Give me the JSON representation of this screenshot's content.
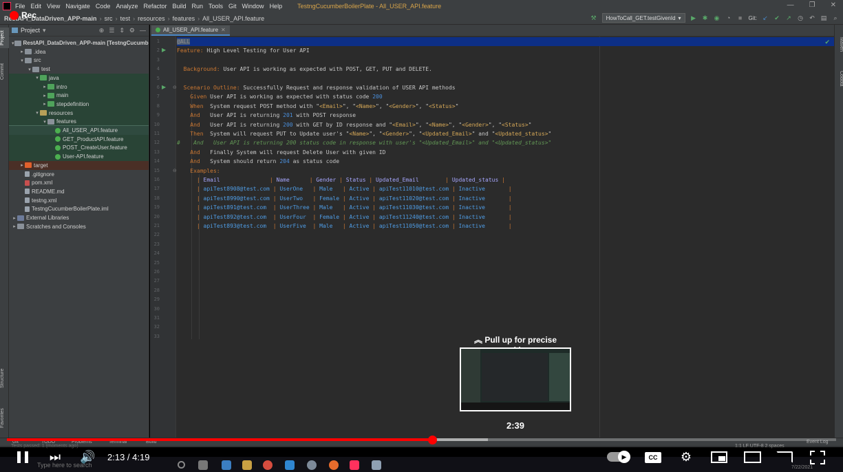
{
  "menubar": {
    "items": [
      "File",
      "Edit",
      "View",
      "Navigate",
      "Code",
      "Analyze",
      "Refactor",
      "Build",
      "Run",
      "Tools",
      "Git",
      "Window",
      "Help"
    ],
    "window_title": "TestngCucumberBoilerPlate - All_USER_API.feature"
  },
  "recording": {
    "label": "Rec"
  },
  "navbar": {
    "breadcrumbs": [
      "RestAPI_DataDriven_APP-main",
      "src",
      "test",
      "resources",
      "features",
      "All_USER_API.feature"
    ],
    "run_config": "HowToCall_GET.testGivenId",
    "git_label": "Git:"
  },
  "side_tabs": {
    "left": [
      "Project",
      "Commit",
      "Structure",
      "Favorites"
    ],
    "right": [
      "Maven",
      "Codota"
    ]
  },
  "project_panel": {
    "title": "Project",
    "tree": [
      {
        "label": "RestAPI_DataDriven_APP-main [TestngCucumberBo",
        "indent": 0,
        "arrow": "▾",
        "icon": "folder"
      },
      {
        "label": ".idea",
        "indent": 1,
        "arrow": "▸",
        "icon": "folder"
      },
      {
        "label": "src",
        "indent": 1,
        "arrow": "▾",
        "icon": "folder"
      },
      {
        "label": "test",
        "indent": 2,
        "arrow": "▾",
        "icon": "folder"
      },
      {
        "label": "java",
        "indent": 3,
        "arrow": "▾",
        "icon": "folder-test",
        "style": "green"
      },
      {
        "label": "intro",
        "indent": 4,
        "arrow": "▸",
        "icon": "folder-test",
        "style": "green"
      },
      {
        "label": "main",
        "indent": 4,
        "arrow": "▸",
        "icon": "folder-test",
        "style": "green"
      },
      {
        "label": "stepdefinition",
        "indent": 4,
        "arrow": "▸",
        "icon": "folder-test",
        "style": "green"
      },
      {
        "label": "resources",
        "indent": 3,
        "arrow": "▾",
        "icon": "folder-res",
        "style": "green"
      },
      {
        "label": "features",
        "indent": 4,
        "arrow": "▾",
        "icon": "folder",
        "style": "green"
      },
      {
        "label": "All_USER_API.feature",
        "indent": 5,
        "arrow": "",
        "icon": "cuke",
        "style": "sel"
      },
      {
        "label": "GET_ProductAPI.feature",
        "indent": 5,
        "arrow": "",
        "icon": "cuke",
        "style": "green"
      },
      {
        "label": "POST_CreateUser.feature",
        "indent": 5,
        "arrow": "",
        "icon": "cuke",
        "style": "green"
      },
      {
        "label": "User-API.feature",
        "indent": 5,
        "arrow": "",
        "icon": "cuke",
        "style": "green"
      },
      {
        "label": "target",
        "indent": 1,
        "arrow": "▸",
        "icon": "folder-target",
        "style": "red"
      },
      {
        "label": ".gitignore",
        "indent": 1,
        "arrow": "",
        "icon": "file"
      },
      {
        "label": "pom.xml",
        "indent": 1,
        "arrow": "",
        "icon": "mvn"
      },
      {
        "label": "README.md",
        "indent": 1,
        "arrow": "",
        "icon": "file"
      },
      {
        "label": "testng.xml",
        "indent": 1,
        "arrow": "",
        "icon": "file"
      },
      {
        "label": "TestngCucumberBoilerPlate.iml",
        "indent": 1,
        "arrow": "",
        "icon": "file"
      },
      {
        "label": "External Libraries",
        "indent": 0,
        "arrow": "▸",
        "icon": "lib"
      },
      {
        "label": "Scratches and Consoles",
        "indent": 0,
        "arrow": "▸",
        "icon": "folder"
      }
    ]
  },
  "editor": {
    "tab_label": "All_USER_API.feature",
    "lines": [
      {
        "n": 1,
        "current": true,
        "segs": [
          [
            "tag",
            "@ALL"
          ]
        ]
      },
      {
        "n": 2,
        "run": true,
        "segs": [
          [
            "kw",
            "Feature:"
          ],
          [
            "tx",
            " High Level Testing for User API"
          ]
        ]
      },
      {
        "n": 3,
        "segs": []
      },
      {
        "n": 4,
        "segs": [
          [
            "tx",
            "  "
          ],
          [
            "kw",
            "Background:"
          ],
          [
            "tx",
            " User API is working as expected with POST, GET, PUT and DELETE."
          ]
        ]
      },
      {
        "n": 5,
        "segs": []
      },
      {
        "n": 6,
        "run": true,
        "fold": true,
        "segs": [
          [
            "tx",
            "  "
          ],
          [
            "kw",
            "Scenario Outline:"
          ],
          [
            "tx",
            " Successfully Request and response validation of USER API methods"
          ]
        ]
      },
      {
        "n": 7,
        "segs": [
          [
            "tx",
            "    "
          ],
          [
            "kw",
            "Given"
          ],
          [
            "tx",
            " User API is working as expected with status code "
          ],
          [
            "num",
            "200"
          ]
        ]
      },
      {
        "n": 8,
        "segs": [
          [
            "tx",
            "    "
          ],
          [
            "kw",
            "When"
          ],
          [
            "tx",
            "  System request POST method with \""
          ],
          [
            "ph",
            "<Email>"
          ],
          [
            "tx",
            "\", \""
          ],
          [
            "ph",
            "<Name>"
          ],
          [
            "tx",
            "\", \""
          ],
          [
            "ph",
            "<Gender>"
          ],
          [
            "tx",
            "\", \""
          ],
          [
            "ph",
            "<Status>"
          ],
          [
            "tx",
            "\""
          ]
        ]
      },
      {
        "n": 9,
        "segs": [
          [
            "tx",
            "    "
          ],
          [
            "kw",
            "And"
          ],
          [
            "tx",
            "   User API is returning "
          ],
          [
            "num",
            "201"
          ],
          [
            "tx",
            " with POST response"
          ]
        ]
      },
      {
        "n": 10,
        "segs": [
          [
            "tx",
            "    "
          ],
          [
            "kw",
            "And"
          ],
          [
            "tx",
            "   User API is returning "
          ],
          [
            "num",
            "200"
          ],
          [
            "tx",
            " with GET by ID response and \""
          ],
          [
            "ph",
            "<Email>"
          ],
          [
            "tx",
            "\", \""
          ],
          [
            "ph",
            "<Name>"
          ],
          [
            "tx",
            "\", \""
          ],
          [
            "ph",
            "<Gender>"
          ],
          [
            "tx",
            "\", \""
          ],
          [
            "ph",
            "<Status>"
          ],
          [
            "tx",
            "\""
          ]
        ]
      },
      {
        "n": 11,
        "segs": [
          [
            "tx",
            "    "
          ],
          [
            "kw",
            "Then"
          ],
          [
            "tx",
            "  System will request PUT to Update user's \""
          ],
          [
            "ph",
            "<Name>"
          ],
          [
            "tx",
            "\", \""
          ],
          [
            "ph",
            "<Gender>"
          ],
          [
            "tx",
            "\", \""
          ],
          [
            "ph",
            "<Updated_Email>"
          ],
          [
            "tx",
            "\" and \""
          ],
          [
            "ph",
            "<Updated_status>"
          ],
          [
            "tx",
            "\""
          ]
        ]
      },
      {
        "n": 12,
        "segs": [
          [
            "cm",
            "#    And   User API is returning 200 status code in response with user's \"<Updated_Email>\" and \"<Updated_status>\""
          ]
        ]
      },
      {
        "n": 13,
        "segs": [
          [
            "tx",
            "    "
          ],
          [
            "kw",
            "And"
          ],
          [
            "tx",
            "   Finally System will request Delete User with given ID"
          ]
        ]
      },
      {
        "n": 14,
        "segs": [
          [
            "tx",
            "    "
          ],
          [
            "kw",
            "And"
          ],
          [
            "tx",
            "   System should return "
          ],
          [
            "num",
            "204"
          ],
          [
            "tx",
            " as status code"
          ]
        ]
      },
      {
        "n": 15,
        "fold": true,
        "segs": [
          [
            "tx",
            "    "
          ],
          [
            "kw",
            "Examples:"
          ]
        ]
      },
      {
        "n": 16,
        "segs": [
          [
            "tx",
            "      "
          ],
          [
            "pipe",
            "| "
          ],
          [
            "tbl-h",
            "Email               "
          ],
          [
            "pipe",
            "| "
          ],
          [
            "tbl-h",
            "Name      "
          ],
          [
            "pipe",
            "| "
          ],
          [
            "tbl-h",
            "Gender "
          ],
          [
            "pipe",
            "| "
          ],
          [
            "tbl-h",
            "Status "
          ],
          [
            "pipe",
            "| "
          ],
          [
            "tbl-h",
            "Updated_Email        "
          ],
          [
            "pipe",
            "| "
          ],
          [
            "tbl-h",
            "Updated_status "
          ],
          [
            "pipe",
            "|"
          ]
        ]
      },
      {
        "n": 17,
        "segs": [
          [
            "tx",
            "      "
          ],
          [
            "pipe",
            "| "
          ],
          [
            "tbl-c",
            "apiTest8908@test.com"
          ],
          [
            "pipe",
            " | "
          ],
          [
            "tbl-c",
            "UserOne  "
          ],
          [
            "pipe",
            " | "
          ],
          [
            "tbl-c",
            "Male  "
          ],
          [
            "pipe",
            " | "
          ],
          [
            "tbl-c",
            "Active"
          ],
          [
            "pipe",
            " | "
          ],
          [
            "tbl-c",
            "apiTest11010@test.com"
          ],
          [
            "pipe",
            " | "
          ],
          [
            "tbl-c",
            "Inactive      "
          ],
          [
            "pipe",
            " |"
          ]
        ]
      },
      {
        "n": 18,
        "segs": [
          [
            "tx",
            "      "
          ],
          [
            "pipe",
            "| "
          ],
          [
            "tbl-c",
            "apiTest8990@test.com"
          ],
          [
            "pipe",
            " | "
          ],
          [
            "tbl-c",
            "UserTwo  "
          ],
          [
            "pipe",
            " | "
          ],
          [
            "tbl-c",
            "Female"
          ],
          [
            "pipe",
            " | "
          ],
          [
            "tbl-c",
            "Active"
          ],
          [
            "pipe",
            " | "
          ],
          [
            "tbl-c",
            "apiTest11020@test.com"
          ],
          [
            "pipe",
            " | "
          ],
          [
            "tbl-c",
            "Inactive      "
          ],
          [
            "pipe",
            " |"
          ]
        ]
      },
      {
        "n": 19,
        "segs": [
          [
            "tx",
            "      "
          ],
          [
            "pipe",
            "| "
          ],
          [
            "tbl-c",
            "apiTest891@test.com "
          ],
          [
            "pipe",
            " | "
          ],
          [
            "tbl-c",
            "UserThree"
          ],
          [
            "pipe",
            " | "
          ],
          [
            "tbl-c",
            "Male  "
          ],
          [
            "pipe",
            " | "
          ],
          [
            "tbl-c",
            "Active"
          ],
          [
            "pipe",
            " | "
          ],
          [
            "tbl-c",
            "apiTest11030@test.com"
          ],
          [
            "pipe",
            " | "
          ],
          [
            "tbl-c",
            "Inactive      "
          ],
          [
            "pipe",
            " |"
          ]
        ]
      },
      {
        "n": 20,
        "segs": [
          [
            "tx",
            "      "
          ],
          [
            "pipe",
            "| "
          ],
          [
            "tbl-c",
            "apiTest892@test.com "
          ],
          [
            "pipe",
            " | "
          ],
          [
            "tbl-c",
            "UserFour "
          ],
          [
            "pipe",
            " | "
          ],
          [
            "tbl-c",
            "Female"
          ],
          [
            "pipe",
            " | "
          ],
          [
            "tbl-c",
            "Active"
          ],
          [
            "pipe",
            " | "
          ],
          [
            "tbl-c",
            "apiTest11240@test.com"
          ],
          [
            "pipe",
            " | "
          ],
          [
            "tbl-c",
            "Inactive      "
          ],
          [
            "pipe",
            " |"
          ]
        ]
      },
      {
        "n": 21,
        "segs": [
          [
            "tx",
            "      "
          ],
          [
            "pipe",
            "| "
          ],
          [
            "tbl-c",
            "apiTest893@test.com "
          ],
          [
            "pipe",
            " | "
          ],
          [
            "tbl-c",
            "UserFive "
          ],
          [
            "pipe",
            " | "
          ],
          [
            "tbl-c",
            "Male  "
          ],
          [
            "pipe",
            " | "
          ],
          [
            "tbl-c",
            "Active"
          ],
          [
            "pipe",
            " | "
          ],
          [
            "tbl-c",
            "apiTest11050@test.com"
          ],
          [
            "pipe",
            " | "
          ],
          [
            "tbl-c",
            "Inactive      "
          ],
          [
            "pipe",
            " |"
          ]
        ]
      },
      {
        "n": 22,
        "segs": []
      },
      {
        "n": 23,
        "segs": []
      },
      {
        "n": 24,
        "segs": []
      },
      {
        "n": 25,
        "segs": []
      },
      {
        "n": 26,
        "segs": []
      },
      {
        "n": 27,
        "segs": []
      },
      {
        "n": 28,
        "segs": []
      },
      {
        "n": 29,
        "segs": []
      },
      {
        "n": 30,
        "segs": []
      },
      {
        "n": 31,
        "segs": []
      },
      {
        "n": 32,
        "segs": []
      },
      {
        "n": 33,
        "segs": []
      }
    ]
  },
  "statusbar": {
    "items": [
      "Git",
      "TODO",
      "Problems",
      "Terminal",
      "Build"
    ],
    "message": "Tests passed: 1 (moments ago)",
    "event_log": "Event Log",
    "right_info": "1:1   LF   UTF-8   2 spaces"
  },
  "video_player": {
    "current_time": "2:13",
    "duration": "4:19",
    "time_separator": " / ",
    "played_fraction": 0.513,
    "buffered_fraction": 0.58,
    "preview_hint": "Pull up for precise seeking",
    "preview_time": "2:39",
    "cc_label": "CC",
    "colors": {
      "progress": "#ff0000"
    }
  },
  "taskbar": {
    "search_placeholder": "Type here to search",
    "date": "7/22/2021"
  }
}
